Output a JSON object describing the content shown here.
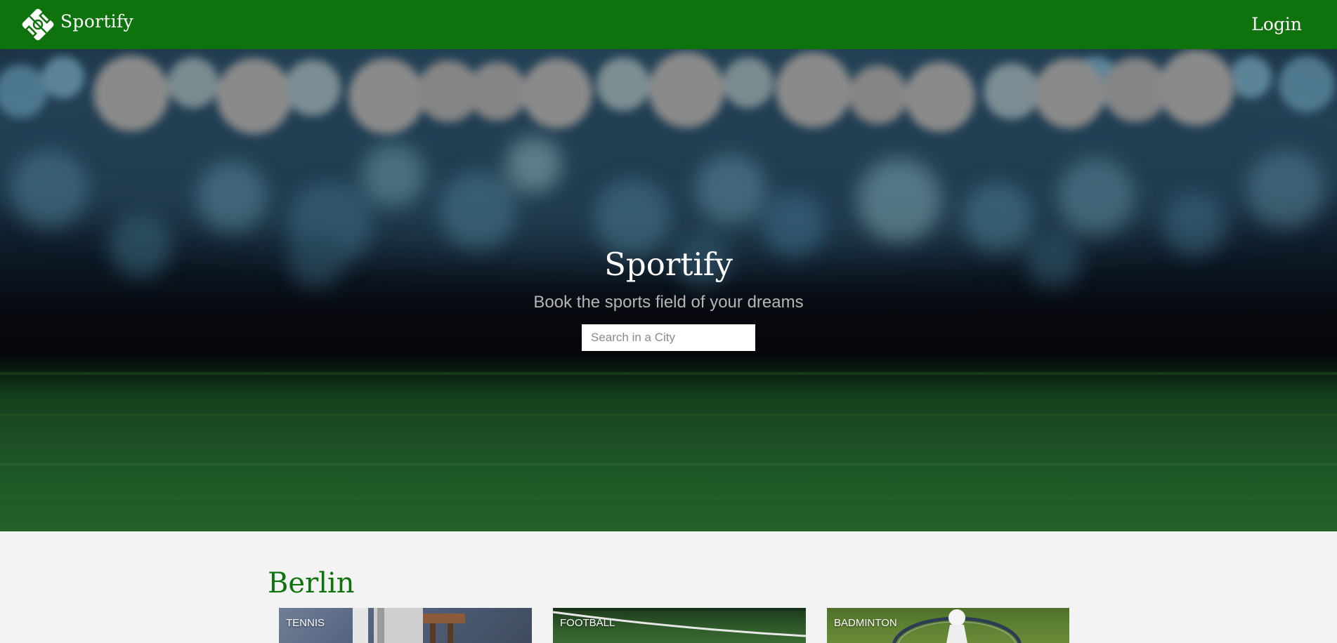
{
  "nav": {
    "brand": "Sportify",
    "login_label": "Login"
  },
  "hero": {
    "title": "Sportify",
    "subtitle": "Book the sports field of your dreams",
    "search_placeholder": "Search in a City"
  },
  "section": {
    "city": "Berlin",
    "cards": [
      {
        "label": "TENNIS"
      },
      {
        "label": "FOOTBALL"
      },
      {
        "label": "BADMINTON"
      }
    ]
  },
  "colors": {
    "brand_green": "#0e730c",
    "page_background": "#f4f3f4"
  }
}
